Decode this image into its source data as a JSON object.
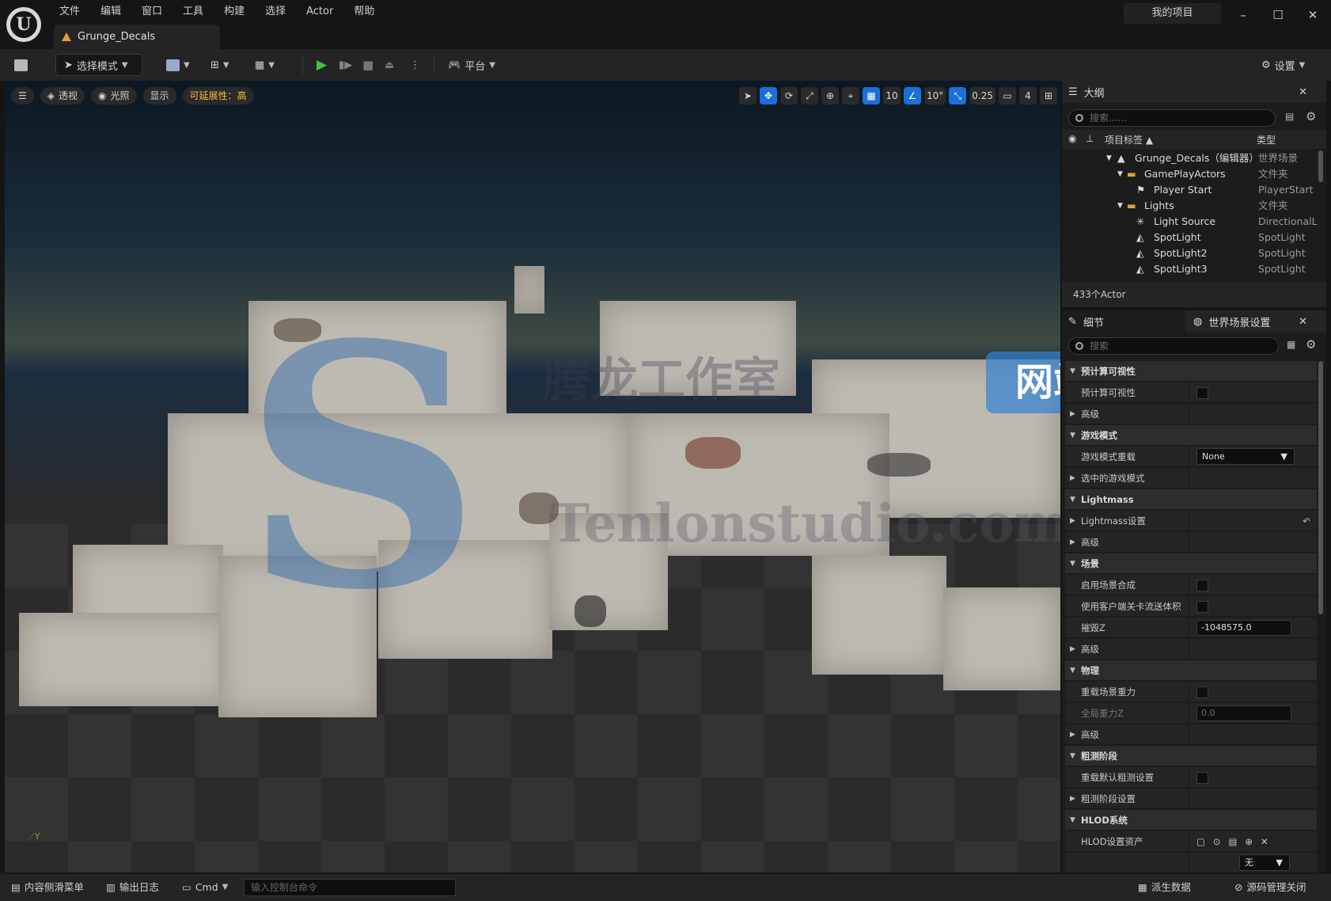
{
  "menu": [
    "文件",
    "编辑",
    "窗口",
    "工具",
    "构建",
    "选择",
    "Actor",
    "帮助"
  ],
  "doc_tab": "Grunge_Decals",
  "project_name": "我的项目",
  "window_controls": {
    "minimize": "–",
    "maximize": "☐",
    "close": "✕"
  },
  "toolbar": {
    "select_mode": "选择模式",
    "platform": "平台",
    "settings": "设置"
  },
  "viewport": {
    "view_mode": "透视",
    "lighting": "光照",
    "show": "显示",
    "scalability": "可延展性：高",
    "grid_snap": "10",
    "rotation_snap": "10°",
    "scale_snap": "0.25",
    "camera_speed": "4",
    "axis_label": "Y"
  },
  "watermark": {
    "site": "网站",
    "domain": "Tenlonstudio.com",
    "chars": "腾龙工作室"
  },
  "outliner": {
    "title": "大纲",
    "search_placeholder": "搜索......",
    "col_label": "项目标签 ▲",
    "col_type": "类型",
    "rows": [
      {
        "label": "Grunge_Decals（编辑器）",
        "type": "世界场景"
      },
      {
        "label": "GamePlayActors",
        "type": "文件夹"
      },
      {
        "label": "Player Start",
        "type": "PlayerStart"
      },
      {
        "label": "Lights",
        "type": "文件夹"
      },
      {
        "label": "Light Source",
        "type": "DirectionalL"
      },
      {
        "label": "SpotLight",
        "type": "SpotLight"
      },
      {
        "label": "SpotLight2",
        "type": "SpotLight"
      },
      {
        "label": "SpotLight3",
        "type": "SpotLight"
      }
    ],
    "actor_count": "433个Actor"
  },
  "details": {
    "tab_details": "细节",
    "tab_world": "世界场景设置",
    "search_placeholder": "搜索",
    "rows": [
      {
        "kind": "cat",
        "label": "预计算可视性"
      },
      {
        "kind": "prop",
        "label": "预计算可视性",
        "ctrl": "cb"
      },
      {
        "kind": "sub",
        "label": "高级"
      },
      {
        "kind": "cat",
        "label": "游戏模式"
      },
      {
        "kind": "prop",
        "label": "游戏模式重载",
        "ctrl": "dd",
        "value": "None"
      },
      {
        "kind": "sub",
        "label": "选中的游戏模式"
      },
      {
        "kind": "cat",
        "label": "Lightmass"
      },
      {
        "kind": "sub",
        "label": "Lightmass设置",
        "ctrl": "reset"
      },
      {
        "kind": "sub",
        "label": "高级"
      },
      {
        "kind": "cat",
        "label": "场景"
      },
      {
        "kind": "prop",
        "label": "启用场景合成",
        "ctrl": "cb"
      },
      {
        "kind": "prop",
        "label": "使用客户端关卡流送体积",
        "ctrl": "cb"
      },
      {
        "kind": "prop",
        "label": "摧毁Z",
        "ctrl": "inp",
        "value": "-1048575.0"
      },
      {
        "kind": "sub",
        "label": "高级"
      },
      {
        "kind": "cat",
        "label": "物理"
      },
      {
        "kind": "prop",
        "label": "重载场景重力",
        "ctrl": "cb"
      },
      {
        "kind": "propdim",
        "label": "全局重力Z",
        "ctrl": "inpdim",
        "value": "0.0"
      },
      {
        "kind": "sub",
        "label": "高级"
      },
      {
        "kind": "cat",
        "label": "粗测阶段"
      },
      {
        "kind": "prop",
        "label": "重载默认粗测设置",
        "ctrl": "cb"
      },
      {
        "kind": "sub",
        "label": "粗测阶段设置"
      },
      {
        "kind": "cat",
        "label": "HLOD系统"
      },
      {
        "kind": "prop",
        "label": "HLOD设置资产",
        "ctrl": "hlod"
      },
      {
        "kind": "prop",
        "label": "",
        "ctrl": "none-dd",
        "value": "无"
      }
    ]
  },
  "statusbar": {
    "content_drawer": "内容侧滑菜单",
    "output_log": "输出日志",
    "cmd": "Cmd",
    "cmd_placeholder": "输入控制台命令",
    "derived_data": "派生数据",
    "source_control": "源码管理关闭"
  }
}
